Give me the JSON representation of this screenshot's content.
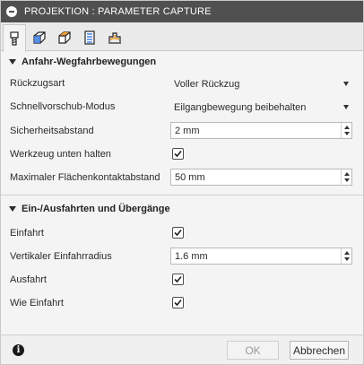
{
  "window": {
    "title": "PROJEKTION : PARAMETER CAPTURE"
  },
  "tabs": [
    {
      "name": "tool-tab",
      "icon": "tool-icon"
    },
    {
      "name": "geometry-tab",
      "icon": "geometry-icon"
    },
    {
      "name": "heights-tab",
      "icon": "heights-icon"
    },
    {
      "name": "passes-tab",
      "icon": "passes-icon"
    },
    {
      "name": "linking-tab",
      "icon": "linking-icon"
    }
  ],
  "sections": {
    "approach": {
      "title": "Anfahr-Wegfahrbewegungen",
      "retract_label": "Rückzugsart",
      "retract_value": "Voller Rückzug",
      "rapid_label": "Schnellvorschub-Modus",
      "rapid_value": "Eilgangbewegung beibehalten",
      "safe_label": "Sicherheitsabstand",
      "safe_value": "2 mm",
      "keep_down_label": "Werkzeug unten halten",
      "keep_down_checked": true,
      "max_stay_label": "Maximaler Flächenkontaktabstand",
      "max_stay_value": "50 mm"
    },
    "leads": {
      "title": "Ein-/Ausfahrten und Übergänge",
      "lead_in_label": "Einfahrt",
      "lead_in_checked": true,
      "vert_radius_label": "Vertikaler Einfahrradius",
      "vert_radius_value": "1.6 mm",
      "lead_out_label": "Ausfahrt",
      "lead_out_checked": true,
      "same_as_in_label": "Wie Einfahrt",
      "same_as_in_checked": true
    }
  },
  "footer": {
    "ok_label": "OK",
    "cancel_label": "Abbrechen",
    "info_glyph": "i"
  },
  "colors": {
    "titlebar": "#505050",
    "background": "#f4f4f4",
    "tab_accent": "#3c7be0",
    "tab_orange": "#f0a030"
  }
}
